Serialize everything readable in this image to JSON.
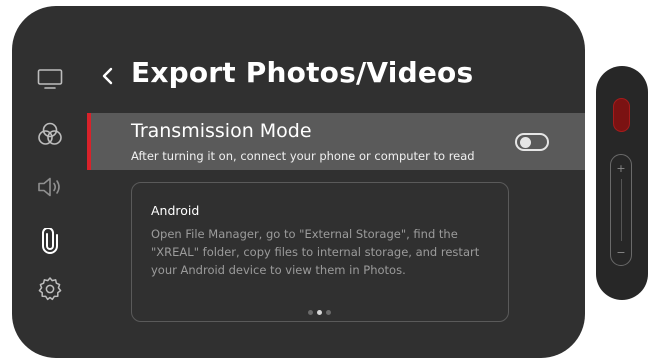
{
  "header": {
    "back_icon": "chevron-left-icon",
    "title": "Export Photos/Videos"
  },
  "sidebar": {
    "items": [
      {
        "icon": "display-icon",
        "selected": false
      },
      {
        "icon": "color-circles-icon",
        "selected": false
      },
      {
        "icon": "speaker-icon",
        "selected": false
      },
      {
        "icon": "paperclip-icon",
        "selected": true
      },
      {
        "icon": "gear-icon",
        "selected": false
      }
    ]
  },
  "setting": {
    "title": "Transmission Mode",
    "description": "After turning it on, connect your phone or computer to read",
    "toggle_on": false
  },
  "info_card": {
    "title": "Android",
    "body": "Open File Manager, go to \"External Storage\", find the \"XREAL\" folder, copy files to internal storage, and restart your Android device to view them in Photos.",
    "page_count": 3,
    "active_page": 2
  },
  "hardware": {
    "volume_up": "+",
    "volume_down": "−"
  },
  "colors": {
    "accent": "#d8222a",
    "panel": "#303030",
    "highlight_row": "#5a5a5a"
  }
}
